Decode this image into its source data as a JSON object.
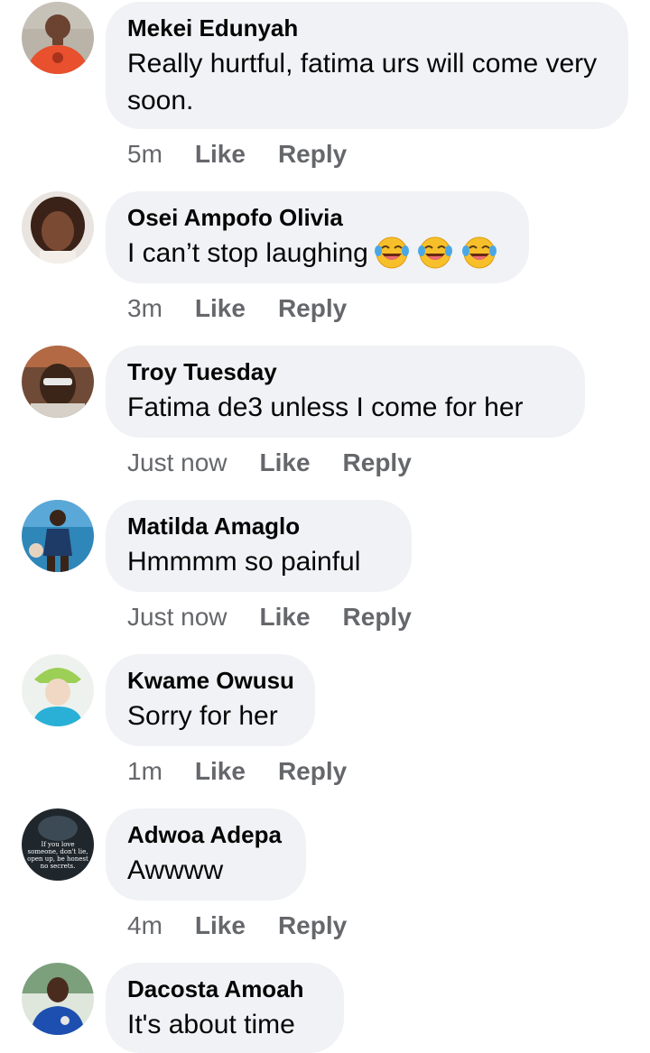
{
  "actions": {
    "like": "Like",
    "reply": "Reply"
  },
  "comments": [
    {
      "author": "Mekei Edunyah",
      "text": "Really hurtful, fatima urs will come very soon.",
      "time": "5m"
    },
    {
      "author": "Osei Ampofo Olivia",
      "text": "I can’t stop laughing",
      "emoji": "face-with-tears-of-joy-icon",
      "time": "3m"
    },
    {
      "author": "Troy Tuesday",
      "text": "Fatima de3 unless I come for her",
      "time": "Just now"
    },
    {
      "author": "Matilda Amaglo",
      "text": "Hmmmm so painful",
      "time": "Just now"
    },
    {
      "author": "Kwame Owusu",
      "text": "Sorry for her",
      "time": "1m"
    },
    {
      "author": "Adwoa Adepa",
      "text": "Awwww",
      "time": "4m",
      "avatar_text": [
        "If you love",
        "someone, don't lie,",
        "open up, be honest",
        "no secrets."
      ]
    },
    {
      "author": "Dacosta Amoah",
      "text": "It's about time"
    }
  ],
  "colors": {
    "bubble": "#f0f2f5",
    "meta": "#65676b",
    "text": "#050505"
  }
}
